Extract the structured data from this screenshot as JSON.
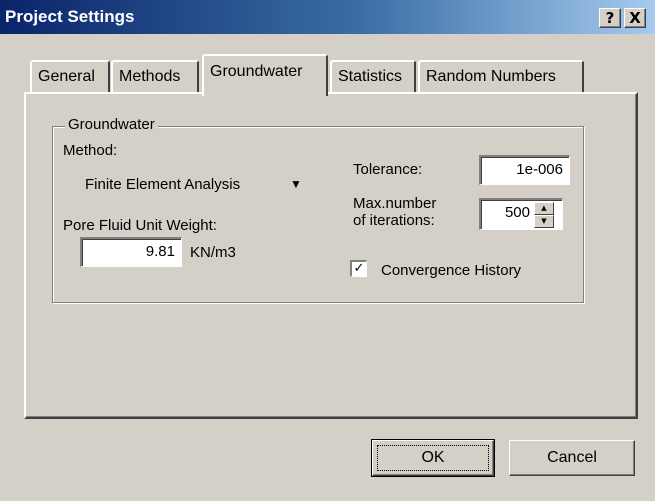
{
  "window": {
    "title": "Project Settings"
  },
  "caption_buttons": {
    "help": "?",
    "close": "X"
  },
  "tabs": [
    {
      "label": "General",
      "active": false
    },
    {
      "label": "Methods",
      "active": false
    },
    {
      "label": "Groundwater",
      "active": true
    },
    {
      "label": "Statistics",
      "active": false
    },
    {
      "label": "Random Numbers",
      "active": false
    }
  ],
  "group": {
    "legend": "Groundwater",
    "method_label": "Method:",
    "method_value": "Finite Element Analysis",
    "pore_label": "Pore Fluid Unit Weight:",
    "pore_value": "9.81",
    "pore_unit": "KN/m3",
    "tolerance_label": "Tolerance:",
    "tolerance_value": "1e-006",
    "max_iter_label_line1": "Max.number",
    "max_iter_label_line2": "of iterations:",
    "max_iter_value": "500",
    "convergence_label": "Convergence History",
    "convergence_checked": true
  },
  "buttons": {
    "ok": "OK",
    "cancel": "Cancel"
  },
  "colors": {
    "face": "#d4d0c8",
    "title_start": "#0a246a",
    "title_end": "#a6caf0",
    "shadow": "#808080",
    "highlight": "#ffffff"
  }
}
